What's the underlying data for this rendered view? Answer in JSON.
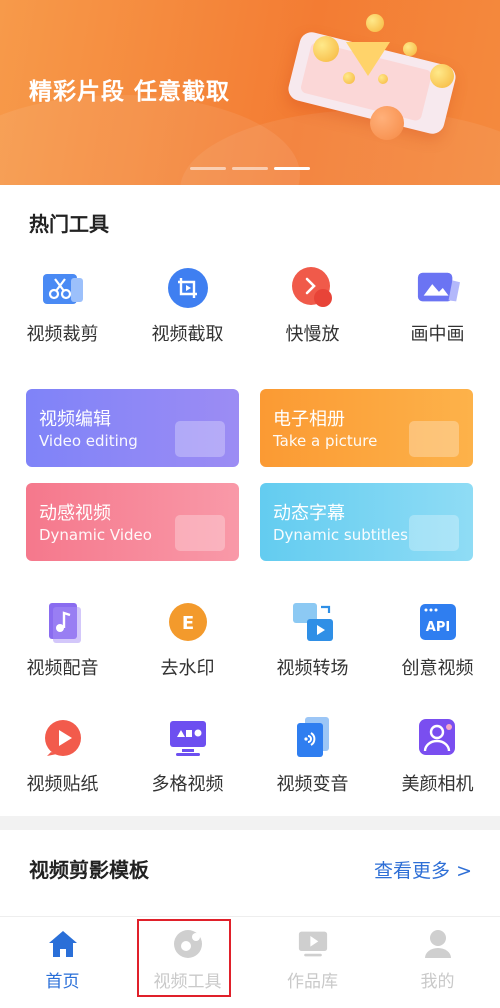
{
  "banner": {
    "title": "精彩片段 任意截取",
    "slide_count": 3,
    "active_slide": 3
  },
  "hot_tools": {
    "title": "热门工具",
    "items": [
      {
        "label": "视频裁剪",
        "icon": "scissors-icon"
      },
      {
        "label": "视频截取",
        "icon": "crop-icon"
      },
      {
        "label": "快慢放",
        "icon": "speed-icon"
      },
      {
        "label": "画中画",
        "icon": "picture-in-picture-icon"
      }
    ]
  },
  "cards": [
    {
      "title": "视频编辑",
      "subtitle": "Video editing",
      "color_from": "#7f83f8",
      "color_to": "#9c8cf4",
      "icon": "video-camera-icon"
    },
    {
      "title": "电子相册",
      "subtitle": "Take a picture",
      "color_from": "#fb9a33",
      "color_to": "#fdb24a",
      "icon": "photo-icon"
    },
    {
      "title": "动感视频",
      "subtitle": "Dynamic Video",
      "color_from": "#f5788c",
      "color_to": "#f999a8",
      "icon": "player-icon"
    },
    {
      "title": "动态字幕",
      "subtitle": "Dynamic subtitles",
      "color_from": "#63ccf0",
      "color_to": "#8fdcf5",
      "icon": "subtitle-icon"
    }
  ],
  "tools_row2": [
    {
      "label": "视频配音",
      "icon": "music-note-icon"
    },
    {
      "label": "去水印",
      "icon": "stamp-icon"
    },
    {
      "label": "视频转场",
      "icon": "transition-icon"
    },
    {
      "label": "创意视频",
      "icon": "api-icon",
      "icon_text": "API"
    }
  ],
  "tools_row3": [
    {
      "label": "视频贴纸",
      "icon": "sticker-icon"
    },
    {
      "label": "多格视频",
      "icon": "grid-video-icon"
    },
    {
      "label": "视频变音",
      "icon": "voice-change-icon"
    },
    {
      "label": "美颜相机",
      "icon": "beauty-camera-icon"
    }
  ],
  "templates": {
    "title": "视频剪影模板",
    "more_label": "查看更多 >"
  },
  "tabs": [
    {
      "label": "首页",
      "icon": "home-icon",
      "active": true
    },
    {
      "label": "视频工具",
      "icon": "video-tool-icon",
      "active": false
    },
    {
      "label": "作品库",
      "icon": "library-icon",
      "active": false
    },
    {
      "label": "我的",
      "icon": "user-icon",
      "active": false
    }
  ],
  "colors": {
    "accent": "#2a6fd8",
    "highlight_box": "#e0202a",
    "banner": "#f37c33"
  }
}
